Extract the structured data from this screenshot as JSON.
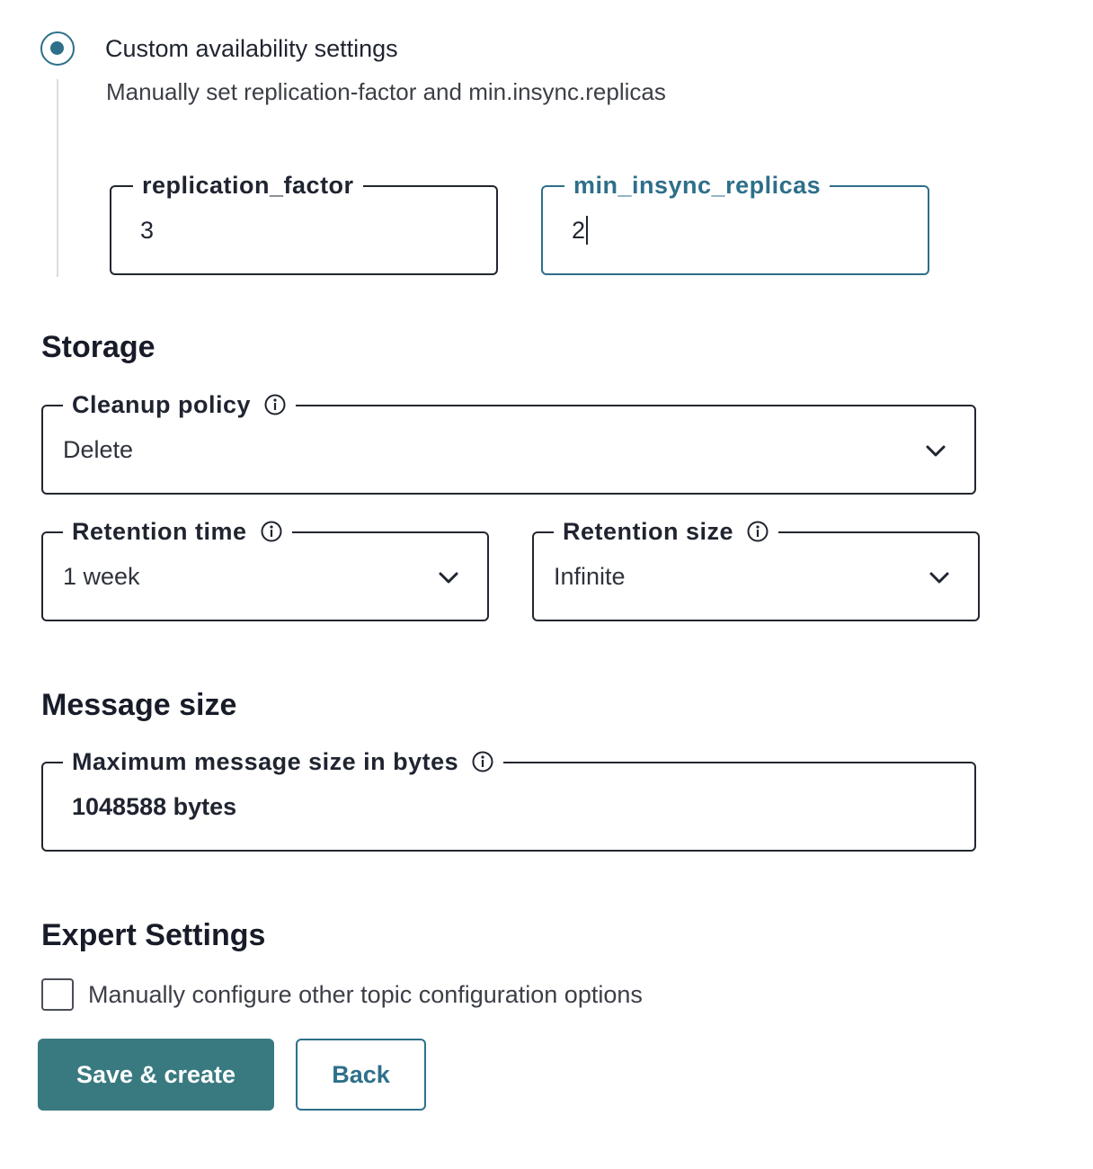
{
  "availability": {
    "radio_label": "Custom availability settings",
    "radio_selected": true,
    "description": "Manually set replication-factor and min.insync.replicas",
    "replication_factor": {
      "label": "replication_factor",
      "value": "3"
    },
    "min_insync_replicas": {
      "label": "min_insync_replicas",
      "value": "2"
    }
  },
  "storage": {
    "heading": "Storage",
    "cleanup_policy": {
      "label": "Cleanup policy",
      "value": "Delete"
    },
    "retention_time": {
      "label": "Retention time",
      "value": "1 week"
    },
    "retention_size": {
      "label": "Retention size",
      "value": "Infinite"
    }
  },
  "message_size": {
    "heading": "Message size",
    "max_size": {
      "label": "Maximum message size in bytes",
      "value": "1048588 bytes"
    }
  },
  "expert": {
    "heading": "Expert Settings",
    "checkbox_label": "Manually configure other topic configuration options",
    "checked": false
  },
  "actions": {
    "save_label": "Save & create",
    "back_label": "Back"
  },
  "colors": {
    "accent": "#2e6f8a",
    "primary_button": "#397a80",
    "text": "#1f2430"
  },
  "icons": {
    "info": "info-circle-icon",
    "dropdown": "chevron-down-icon"
  }
}
